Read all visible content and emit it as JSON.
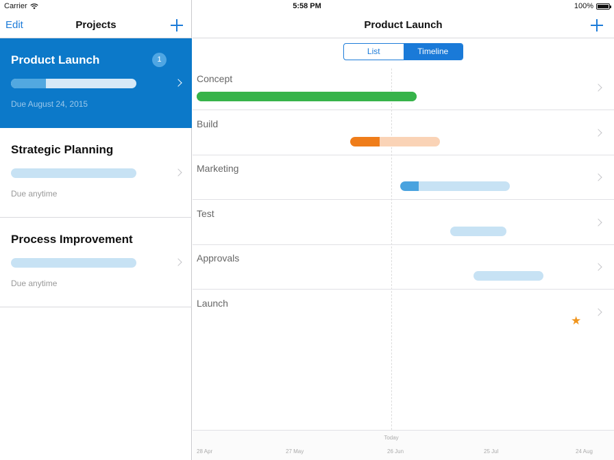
{
  "status": {
    "carrier": "Carrier",
    "time": "5:58 PM",
    "battery": "100%"
  },
  "sidebar": {
    "edit_label": "Edit",
    "title": "Projects",
    "projects": [
      {
        "title": "Product Launch",
        "progress": 0.28,
        "due": "Due August 24, 2015",
        "badge": "1",
        "selected": true
      },
      {
        "title": "Strategic Planning",
        "progress": 0,
        "due": "Due anytime",
        "selected": false
      },
      {
        "title": "Process Improvement",
        "progress": 0,
        "due": "Due anytime",
        "selected": false
      }
    ]
  },
  "main": {
    "title": "Product Launch",
    "segments": [
      {
        "label": "List",
        "active": false
      },
      {
        "label": "Timeline",
        "active": true
      }
    ],
    "tasks": [
      {
        "label": "Concept",
        "progress": 1.0,
        "color": "#37b34a",
        "track": "#37b34a"
      },
      {
        "label": "Build",
        "progress": 0.33,
        "color": "#ef7d1a",
        "track": "#fad3b6"
      },
      {
        "label": "Marketing",
        "progress": 0.17,
        "color": "#4aa3df",
        "track": "#c7e2f4"
      },
      {
        "label": "Test",
        "progress": 0,
        "color": "#4aa3df",
        "track": "#c7e2f4"
      },
      {
        "label": "Approvals",
        "progress": 0,
        "color": "#4aa3df",
        "track": "#c7e2f4"
      },
      {
        "label": "Launch",
        "milestone": true,
        "color": "#f0951d"
      }
    ],
    "axis": {
      "today_label": "Today",
      "ticks": [
        "28 Apr",
        "27 May",
        "26 Jun",
        "25 Jul",
        "24 Aug"
      ]
    }
  },
  "colors": {
    "accent": "#1a7ad8",
    "selected_row": "#0c79c9"
  }
}
